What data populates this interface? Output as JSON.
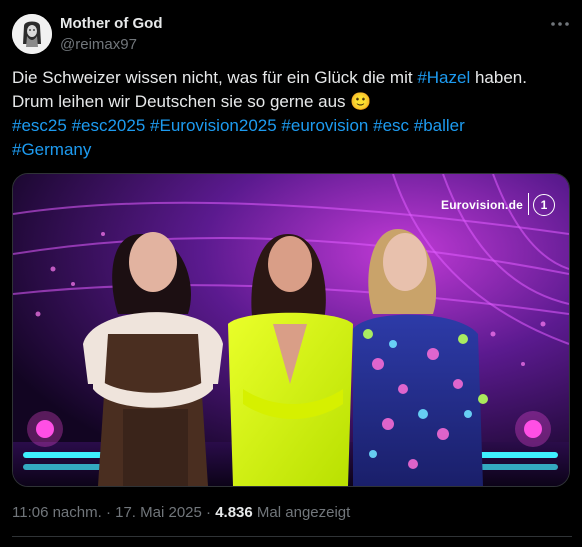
{
  "author": {
    "name": "Mother of God",
    "handle": "@reimax97"
  },
  "tweet": {
    "line1_before": "Die Schweizer wissen nicht, was für ein Glück die mit ",
    "line1_hashtag": "#Hazel",
    "line1_after": " haben.",
    "line2": "Drum leihen wir Deutschen sie so gerne aus",
    "emoji": "🙂",
    "hashtags_line3": [
      "#esc25",
      "#esc2025",
      "#Eurovision2025",
      "#eurovision",
      "#esc",
      "#baller"
    ],
    "hashtags_line4": [
      "#Germany"
    ]
  },
  "media": {
    "watermark": "Eurovision.de",
    "logo": "1",
    "logo_icon": "ard-one-logo"
  },
  "meta": {
    "time": "11:06 nachm.",
    "separator": "·",
    "date": "17. Mai 2025",
    "views": "4.836",
    "views_label": "Mal angezeigt"
  },
  "colors": {
    "background": "#000000",
    "text": "#e7e9ea",
    "muted": "#71767b",
    "link": "#1d9bf0"
  }
}
